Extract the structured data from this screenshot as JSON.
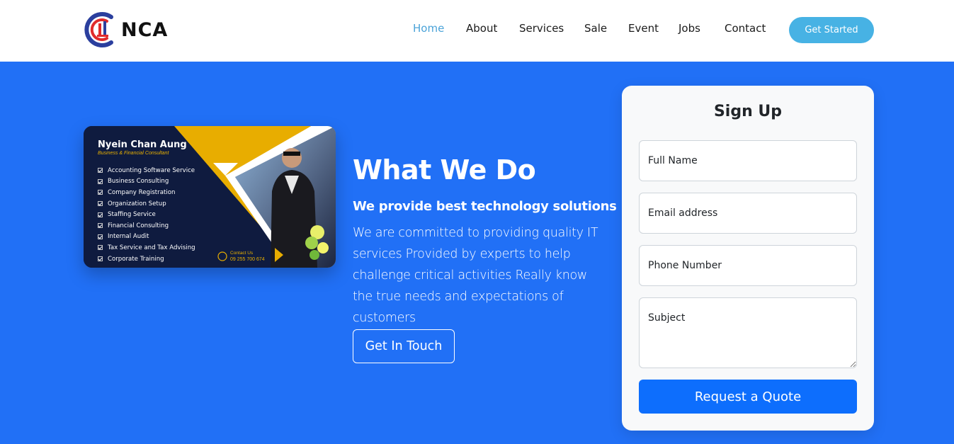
{
  "logo": {
    "text": "NCA"
  },
  "nav": {
    "items": [
      {
        "label": "Home",
        "active": true
      },
      {
        "label": "About"
      },
      {
        "label": "Services"
      },
      {
        "label": "Sale"
      },
      {
        "label": "Event"
      },
      {
        "label": "Jobs"
      },
      {
        "label": "Contact"
      }
    ],
    "cta_label": "Get Started"
  },
  "hero": {
    "title": "What We Do",
    "subtitle": "We provide best technology solutions",
    "body": "We are committed to providing quality IT services Provided by experts to help challenge critical activities Really know the true needs and expectations of customers",
    "cta_label": "Get In Touch"
  },
  "promo_card": {
    "name": "Nyein Chan Aung",
    "role": "Business & Financial Consultant",
    "services": [
      "Accounting Software Service",
      "Business Consulting",
      "Company Registration",
      "Organization Setup",
      "Staffing Service",
      "Financial Consulting",
      "Internal Audit",
      "Tax Service and Tax Advising",
      "Corporate Training"
    ],
    "contact_label": "Contact Us",
    "phone": "09 255 700 674"
  },
  "signup": {
    "title": "Sign Up",
    "full_name_placeholder": "Full Name",
    "email_placeholder": "Email address",
    "phone_placeholder": "Phone Number",
    "subject_placeholder": "Subject",
    "submit_label": "Request a Quote"
  },
  "colors": {
    "hero_bg": "#2170f6",
    "nav_active": "#4ba3d8",
    "cta_bg": "#47b2e4",
    "submit_bg": "#0d6efd",
    "promo_accent": "#e8b000",
    "promo_bg": "#0f1b3f"
  }
}
